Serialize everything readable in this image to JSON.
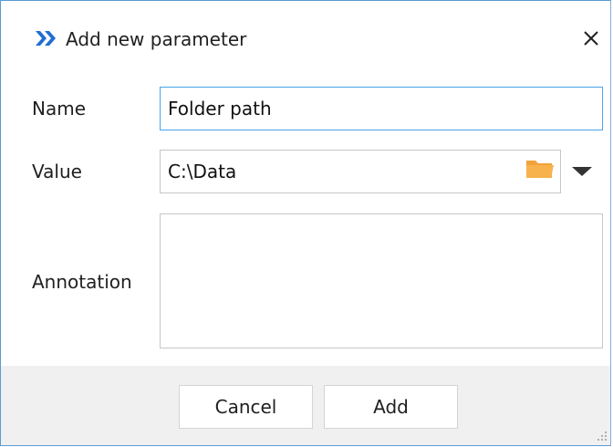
{
  "dialog": {
    "title": "Add new parameter",
    "close_symbol": "×"
  },
  "form": {
    "name_label": "Name",
    "name_value": "Folder path",
    "value_label": "Value",
    "value_value": "C:\\Data",
    "annotation_label": "Annotation",
    "annotation_value": ""
  },
  "buttons": {
    "cancel_label": "Cancel",
    "add_label": "Add"
  },
  "icons": {
    "app": "app-chevron-icon",
    "close": "close-icon",
    "folder": "folder-icon",
    "dropdown": "chevron-down-icon",
    "grip": "resize-grip-icon"
  },
  "colors": {
    "app_icon": "#1f6fd1",
    "focus_border": "#4aa3e8",
    "folder": "#f2a23a",
    "footer_bg": "#f0f0f0"
  }
}
